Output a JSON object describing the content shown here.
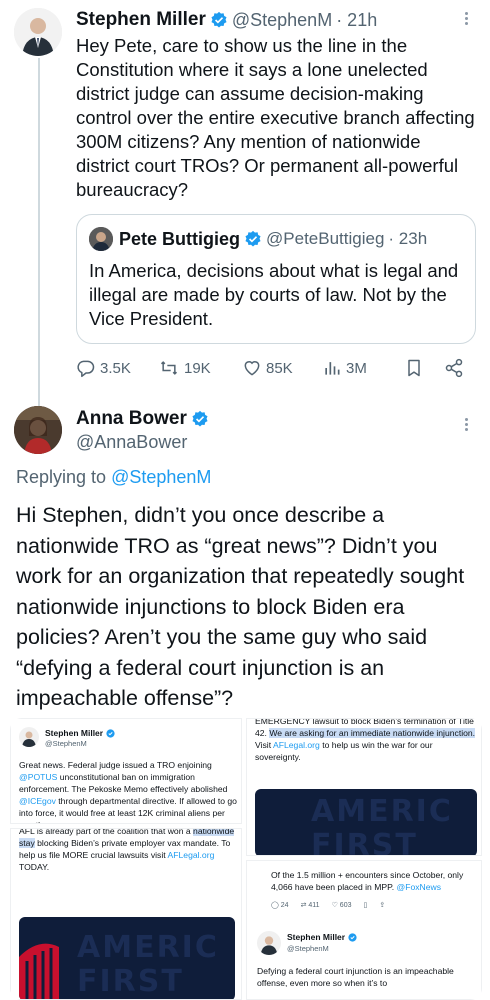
{
  "tweet1": {
    "name": "Stephen Miller",
    "handle": "@StephenM",
    "time": "· 21h",
    "text": "Hey Pete, care to show us the line in the Constitution where it says a lone unelected district judge can assume decision-making control over the entire executive branch affecting 300M citizens? Any mention of nationwide district court TROs? Or permanent all-powerful bureaucracy?",
    "quote": {
      "name": "Pete Buttigieg",
      "handle": "@PeteButtigieg",
      "time": "· 23h",
      "text": "In America, decisions about what is legal and illegal are made by courts of law. Not by the Vice President."
    },
    "actions": {
      "replies": "3.5K",
      "reposts": "19K",
      "likes": "85K",
      "views": "3M"
    }
  },
  "tweet2": {
    "name": "Anna Bower",
    "handle": "@AnnaBower",
    "replying_prefix": "Replying to ",
    "replying_handle": "@StephenM",
    "text": "Hi Stephen, didn’t you once describe a nationwide TRO as “great news”? Didn’t you work for an organization that repeatedly sought nationwide injunctions to block Biden era policies? Aren’t you the same guy who said “defying a federal court injunction is an impeachable offense”?"
  },
  "images": {
    "card1": {
      "name": "Stephen Miller",
      "handle": "@StephenM",
      "text_a": "Great news. Federal judge issued a TRO enjoining ",
      "link_a": "@POTUS",
      "text_b": " unconstitutional ban on immigration enforcement. The Pekoske Memo effectively abolished ",
      "link_b": "@ICEgov",
      "text_c": " through departmental directive. If allowed to go into force, it would free at least 12K criminal aliens per month."
    },
    "card2": {
      "line1": "EMERGENCY lawsuit to block Biden’s termination",
      "line2": "of Title 42. ",
      "hl": "We are asking for an immediate nationwide injunction.",
      "line3": " Visit ",
      "link": "AFLegal.org",
      "line4": " to help us win the war for our sovereignty.",
      "banner": "AMERIC FIRST"
    },
    "card3": {
      "line0": "AFL is already part of the coalition that won a",
      "hl": "nationwide stay",
      "line1": " blocking Biden’s private employer vax mandate. To help us file MORE crucial lawsuits visit ",
      "link": "AFLegal.org",
      "line2": " TODAY.",
      "banner": "AMERIC FIRST"
    },
    "card4": {
      "text_a": "Of the 1.5 million + encounters since October, only 4,066 have been placed in MPP. ",
      "link": "@FoxNews",
      "replies": "24",
      "reposts": "411",
      "likes": "603",
      "name": "Stephen Miller",
      "handle": "@StephenM",
      "text": "Defying a federal court injunction is an impeachable offense, even more so when it’s to"
    }
  },
  "colors": {
    "accent": "#1d9bf0",
    "muted": "#536471",
    "navy": "#0f1d3a",
    "red": "#c8102e"
  }
}
